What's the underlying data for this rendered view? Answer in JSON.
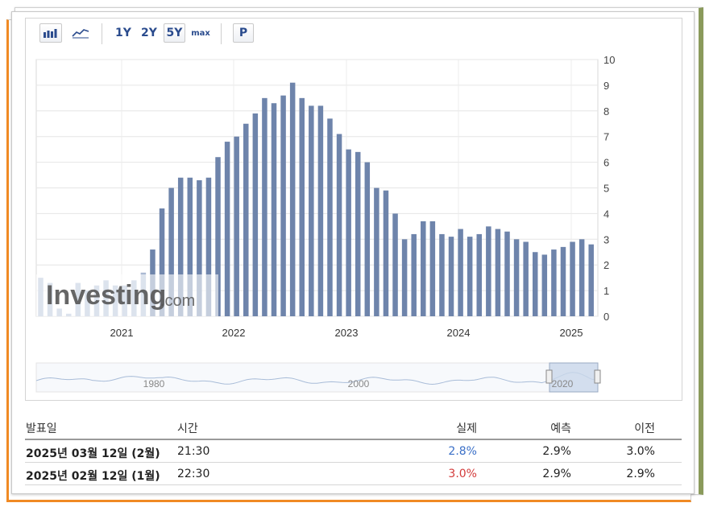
{
  "toolbar": {
    "bar_icon": "bar-chart-icon",
    "line_icon": "line-chart-icon",
    "ranges": [
      "1Y",
      "2Y",
      "5Y",
      "max"
    ],
    "active_range": "5Y",
    "print_label": "P"
  },
  "watermark": {
    "brand": "Investing",
    "suffix": ".com"
  },
  "chart_data": {
    "type": "bar",
    "x_ticks": [
      "2021",
      "2022",
      "2023",
      "2024",
      "2025"
    ],
    "y_ticks": [
      "0",
      "1",
      "2",
      "3",
      "4",
      "5",
      "6",
      "7",
      "8",
      "9",
      "10"
    ],
    "ylim": [
      0,
      10
    ],
    "grid": true,
    "bar_color": "#6e84ab",
    "series": [
      {
        "values": [
          1.5,
          1.3,
          0.3,
          0.1,
          1.3,
          1.0,
          1.2,
          1.4,
          1.2,
          1.2,
          1.4,
          1.7,
          2.6,
          4.2,
          5.0,
          5.4,
          5.4,
          5.3,
          5.4,
          6.2,
          6.8,
          7.0,
          7.5,
          7.9,
          8.5,
          8.3,
          8.6,
          9.1,
          8.5,
          8.2,
          8.2,
          7.7,
          7.1,
          6.5,
          6.4,
          6.0,
          5.0,
          4.9,
          4.0,
          3.0,
          3.2,
          3.7,
          3.7,
          3.2,
          3.1,
          3.4,
          3.1,
          3.2,
          3.5,
          3.4,
          3.3,
          3.0,
          2.9,
          2.5,
          2.4,
          2.6,
          2.7,
          2.9,
          3.0,
          2.8
        ]
      }
    ],
    "navigator": {
      "labels": [
        "1980",
        "2000",
        "2020"
      ]
    }
  },
  "table": {
    "headers": {
      "date": "발표일",
      "time": "시간",
      "actual": "실제",
      "forecast": "예측",
      "previous": "이전"
    },
    "rows": [
      {
        "date": "2025년 03월 12일 (2월)",
        "time": "21:30",
        "actual": "2.8%",
        "actual_color": "#3a6fc7",
        "forecast": "2.9%",
        "previous": "3.0%"
      },
      {
        "date": "2025년 02월 12일 (1월)",
        "time": "22:30",
        "actual": "3.0%",
        "actual_color": "#d33a3a",
        "forecast": "2.9%",
        "previous": "2.9%"
      }
    ]
  }
}
